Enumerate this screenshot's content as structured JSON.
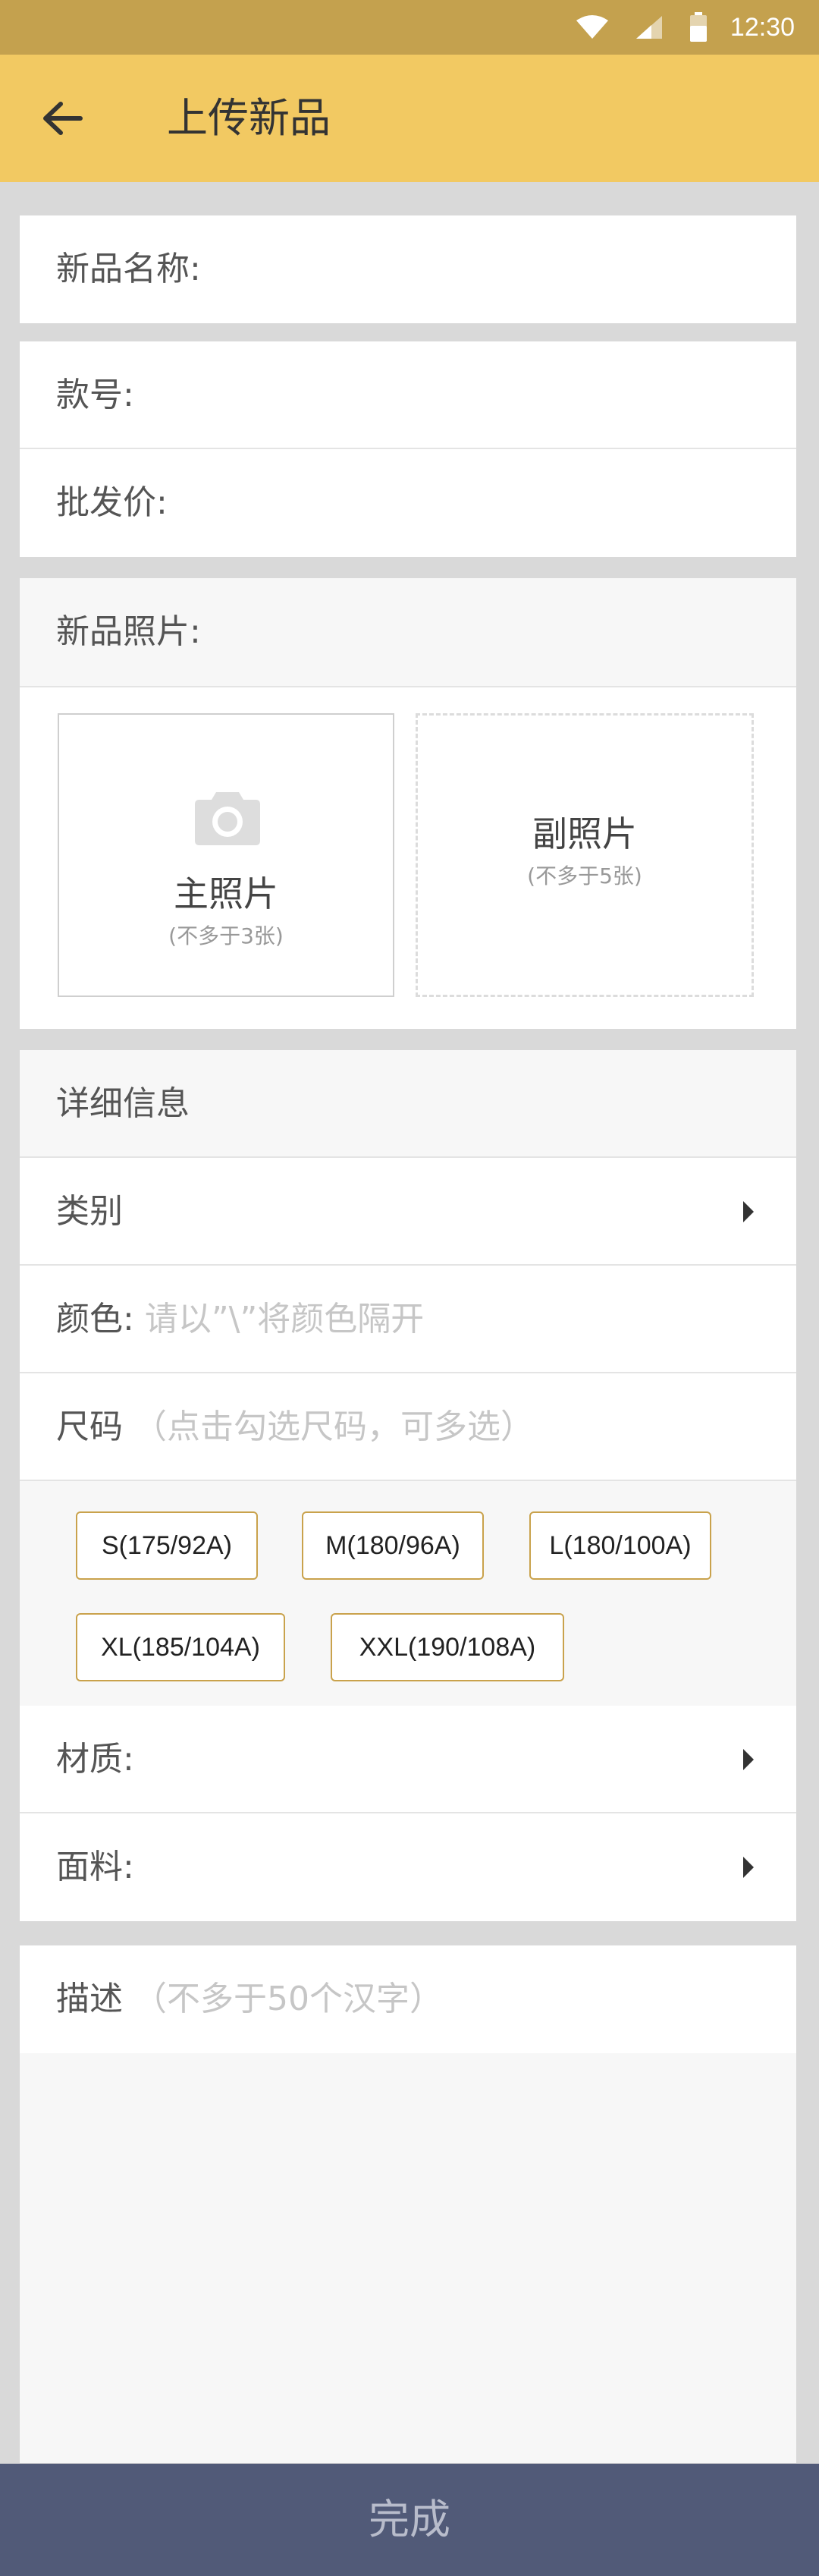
{
  "status_bar": {
    "time": "12:30",
    "icons": [
      "wifi-icon",
      "signal-icon",
      "battery-icon"
    ]
  },
  "app_bar": {
    "title": "上传新品",
    "back_icon": "arrow-left-icon"
  },
  "form": {
    "name_label": "新品名称:",
    "style_no_label": "款号:",
    "wholesale_label": "批发价:",
    "photos_label": "新品照片:",
    "main_photo": {
      "label": "主照片",
      "hint": "(不多于3张)",
      "icon": "camera-icon"
    },
    "sub_photo": {
      "label": "副照片",
      "hint": "(不多于5张)"
    }
  },
  "details": {
    "header": "详细信息",
    "category_label": "类别",
    "color_label": "颜色:",
    "color_placeholder": "请以”\\”将颜色隔开",
    "size_label": "尺码",
    "size_hint": "（点击勾选尺码，可多选）",
    "sizes": [
      "S(175/92A)",
      "M(180/96A)",
      "L(180/100A)",
      "XL(185/104A)",
      "XXL(190/108A)"
    ],
    "material_label": "材质:",
    "fabric_label": "面料:"
  },
  "description": {
    "label": "描述",
    "placeholder": "（不多于50个汉字）"
  },
  "footer": {
    "done_label": "完成"
  },
  "colors": {
    "status_bar": "#c4a14e",
    "app_bar": "#f2c962",
    "chip_border": "#c9a24c",
    "done_bar": "#515a78"
  }
}
